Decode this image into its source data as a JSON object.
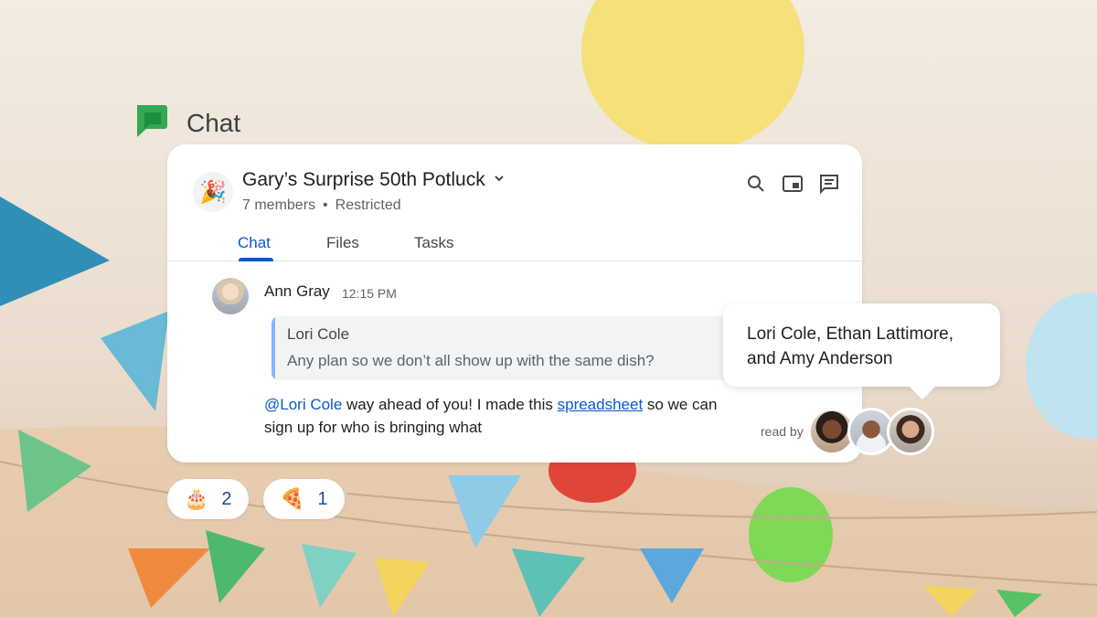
{
  "brand": {
    "name": "Chat",
    "icon": "google-chat-icon"
  },
  "room": {
    "icon": "party-popper-icon",
    "icon_glyph": "🎉",
    "title": "Gary’s Surprise 50th Potluck",
    "members": "7 members",
    "separator": "•",
    "access": "Restricted",
    "actions": [
      "search-icon",
      "picture-in-picture-icon",
      "threads-icon"
    ]
  },
  "tabs": [
    {
      "label": "Chat",
      "active": true
    },
    {
      "label": "Files",
      "active": false
    },
    {
      "label": "Tasks",
      "active": false
    }
  ],
  "message": {
    "sender": "Ann Gray",
    "time": "12:15 PM",
    "quote": {
      "author": "Lori Cole",
      "text": "Any plan so we don’t all show up with the same dish?"
    },
    "mention": "@Lori Cole",
    "text_before_link": " way ahead of you! I made this ",
    "link_text": "spreadsheet",
    "text_after_link": " so we can sign up for who is bringing what",
    "read_by_label": "read by"
  },
  "readers_tooltip": "Lori Cole, Ethan Lattimore, and Amy Anderson",
  "reactions": [
    {
      "emoji": "🎂",
      "count": "2",
      "icon": "birthday-cake-icon"
    },
    {
      "emoji": "🍕",
      "count": "1",
      "icon": "pizza-icon"
    }
  ],
  "colors": {
    "accent_blue": "#0b57d0",
    "brand_green": "#34a853",
    "quote_bar": "#8ab4f8"
  }
}
